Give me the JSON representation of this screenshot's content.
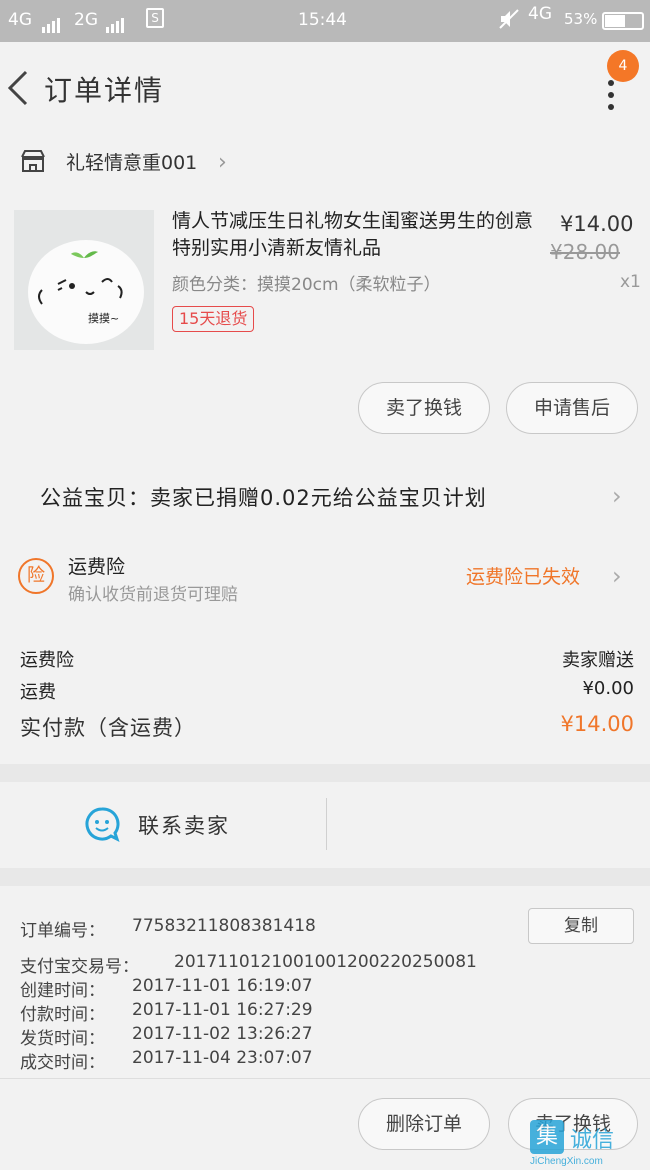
{
  "status_bar": {
    "network1": "4G",
    "network2": "2G",
    "time": "15:44",
    "network3": "4G",
    "battery": "53%"
  },
  "nav": {
    "title": "订单详情",
    "badge": "4"
  },
  "shop": {
    "name": "礼轻情意重001"
  },
  "product": {
    "title": "情人节减压生日礼物女生闺蜜送男生的创意特别实用小清新友情礼品",
    "price": "¥14.00",
    "original_price": "¥28.00",
    "quantity": "x1",
    "spec": "颜色分类：摸摸20cm（柔软粒子）",
    "return_tag": "15天退货",
    "thumb_caption": "摸摸~",
    "buttons": {
      "refund": "卖了换钱",
      "after_sale": "申请售后"
    }
  },
  "charity": {
    "text": "公益宝贝：卖家已捐赠0.02元给公益宝贝计划"
  },
  "insurance": {
    "icon_text": "险",
    "title": "运费险",
    "subtitle": "确认收货前退货可理赔",
    "status": "运费险已失效"
  },
  "fees": {
    "rows": [
      {
        "label": "运费险",
        "value": "卖家赠送"
      },
      {
        "label": "运费",
        "value": "¥0.00"
      }
    ],
    "total_label": "实付款（含运费）",
    "total_value": "¥14.00"
  },
  "contact": {
    "label": "联系卖家"
  },
  "order_info": {
    "order_no_label": "订单编号：",
    "order_no": "77583211808381418",
    "copy_label": "复制",
    "rows": [
      {
        "label": "支付宝交易号：",
        "value": "2017110121001001200220250081"
      },
      {
        "label": "创建时间：",
        "value": "2017-11-01  16:19:07"
      },
      {
        "label": "付款时间：",
        "value": "2017-11-01  16:27:29"
      },
      {
        "label": "发货时间：",
        "value": "2017-11-02  13:26:27"
      },
      {
        "label": "成交时间：",
        "value": "2017-11-04  23:07:07"
      }
    ]
  },
  "bottom": {
    "delete_order": "删除订单",
    "sell": "卖了换钱"
  },
  "watermark": {
    "logo_char": "集",
    "name": "诚信",
    "url": "JiChengXin.com"
  },
  "colors": {
    "accent_orange": "#f0762a",
    "tag_red": "#e64b4b",
    "contact_blue": "#27a4d8"
  }
}
